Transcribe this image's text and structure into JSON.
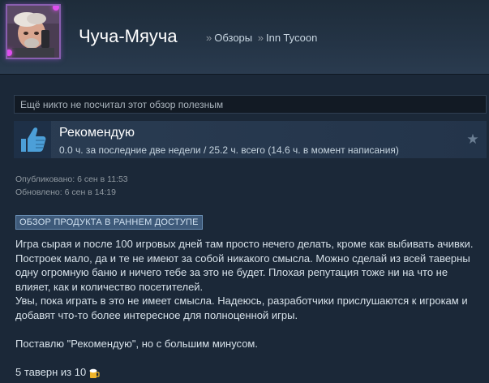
{
  "header": {
    "username": "Чуча-Мяуча",
    "breadcrumbs": [
      "Обзоры",
      "Inn Tycoon"
    ],
    "separator": "»"
  },
  "helpful": {
    "text": "Ещё никто не посчитал этот обзор полезным"
  },
  "recommendation": {
    "title": "Рекомендую",
    "hours": "0.0 ч. за последние две недели / 25.2 ч. всего (14.6 ч. в момент написания)"
  },
  "dates": {
    "published": "Опубликовано: 6 сен в 11:53",
    "updated": "Обновлено: 6 сен в 14:19"
  },
  "badge": {
    "label": "ОБЗОР ПРОДУКТА В РАННЕМ ДОСТУПЕ"
  },
  "review": {
    "paragraph1": "Игра сырая и после 100 игровых дней там просто нечего делать, кроме как выбивать ачивки. Построек мало, да и те не имеют за собой никакого смысла. Можно сделай из всей таверны одну огромную баню и ничего тебе за это не будет. Плохая репутация тоже ни на что не влияет, как и количество посетителей.",
    "paragraph2": "Увы, пока играть в это не имеет смысла. Надеюсь, разработчики прислушаются к игрокам и добавят что-то более интересное для полноценной игры.",
    "paragraph3": "Поставлю \"Рекомендую\", но с большим минусом.",
    "rating": "5 таверн из 10"
  },
  "icons": {
    "thumb": "thumbs-up-icon",
    "star": "star-icon",
    "beer": "beer-icon"
  },
  "colors": {
    "background": "#1b2838",
    "accent": "#4c9fd8",
    "badge": "#3e5a7a",
    "avatar_frame": "#8a5fb0"
  }
}
